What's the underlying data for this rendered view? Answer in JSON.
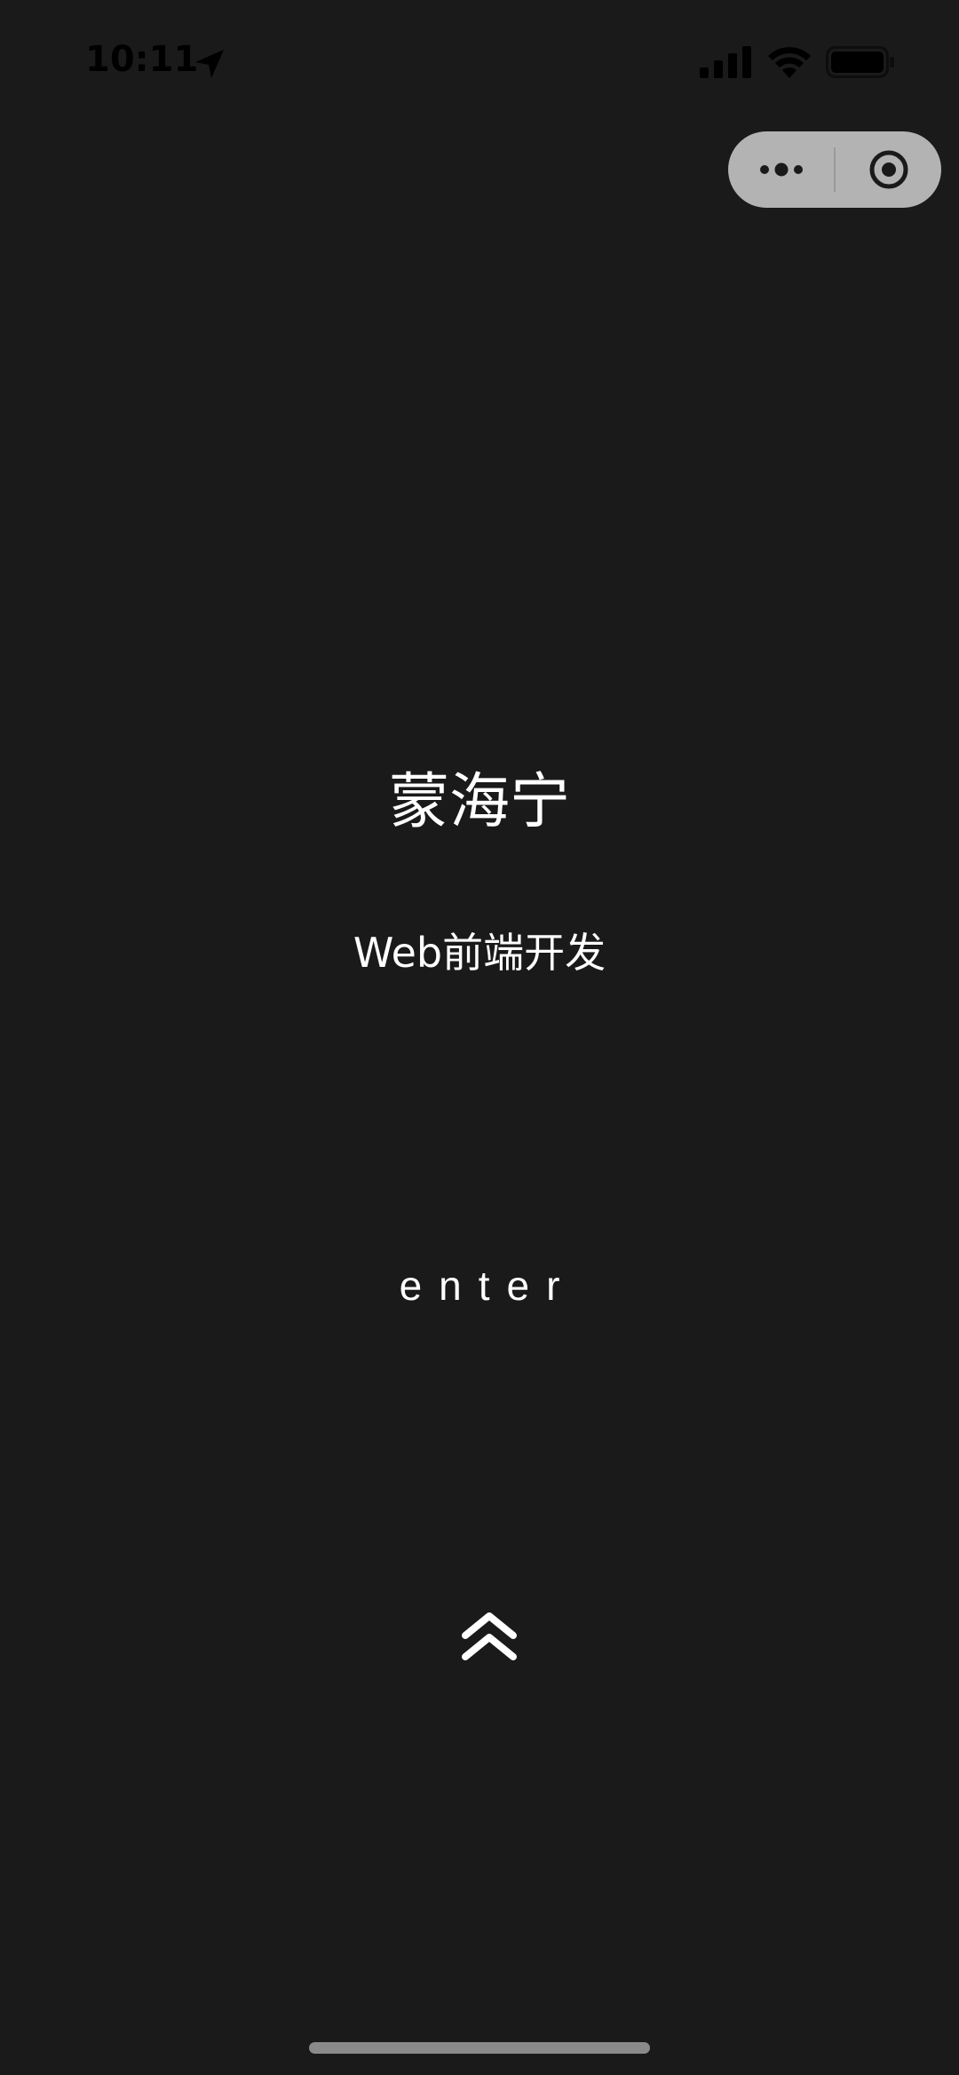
{
  "status_bar": {
    "time": "10:11",
    "icons": [
      "location-arrow-icon",
      "cellular-signal-icon",
      "wifi-icon",
      "battery-icon"
    ]
  },
  "capsule": {
    "icons": [
      "more-dots-icon",
      "close-target-icon"
    ],
    "background": "#b3b3b3"
  },
  "hero": {
    "name": "蒙海宁",
    "title": "Web前端开发",
    "enter_label": "enter",
    "arrow_icon": "double-chevron-up-icon"
  },
  "theme": {
    "background": "#1a1a1a",
    "text": "#ffffff"
  }
}
